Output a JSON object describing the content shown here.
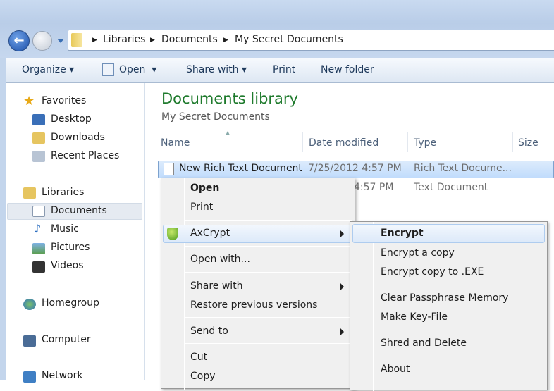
{
  "address": {
    "crumbs": [
      "Libraries",
      "Documents",
      "My Secret Documents"
    ]
  },
  "toolbar": {
    "organize": "Organize",
    "open": "Open",
    "share_with": "Share with",
    "print": "Print",
    "new_folder": "New folder"
  },
  "nav": {
    "favorites": "Favorites",
    "desktop": "Desktop",
    "downloads": "Downloads",
    "recent": "Recent Places",
    "libraries": "Libraries",
    "documents": "Documents",
    "music": "Music",
    "pictures": "Pictures",
    "videos": "Videos",
    "homegroup": "Homegroup",
    "computer": "Computer",
    "network": "Network"
  },
  "main": {
    "title": "Documents library",
    "subtitle": "My Secret Documents",
    "columns": {
      "name": "Name",
      "date": "Date modified",
      "type": "Type",
      "size": "Size"
    },
    "rows": [
      {
        "name": "New Rich Text Document",
        "date": "7/25/2012 4:57 PM",
        "type": "Rich Text Docume..."
      },
      {
        "date": "4:57 PM",
        "type": "Text Document"
      }
    ]
  },
  "context_menu": {
    "open": "Open",
    "print": "Print",
    "axcrypt": "AxCrypt",
    "open_with": "Open with...",
    "share_with": "Share with",
    "restore": "Restore previous versions",
    "send_to": "Send to",
    "cut": "Cut",
    "copy": "Copy"
  },
  "submenu": {
    "encrypt": "Encrypt",
    "encrypt_copy": "Encrypt a copy",
    "encrypt_exe": "Encrypt copy to .EXE",
    "clear": "Clear Passphrase Memory",
    "keyfile": "Make Key-File",
    "shred": "Shred and Delete",
    "about": "About"
  }
}
